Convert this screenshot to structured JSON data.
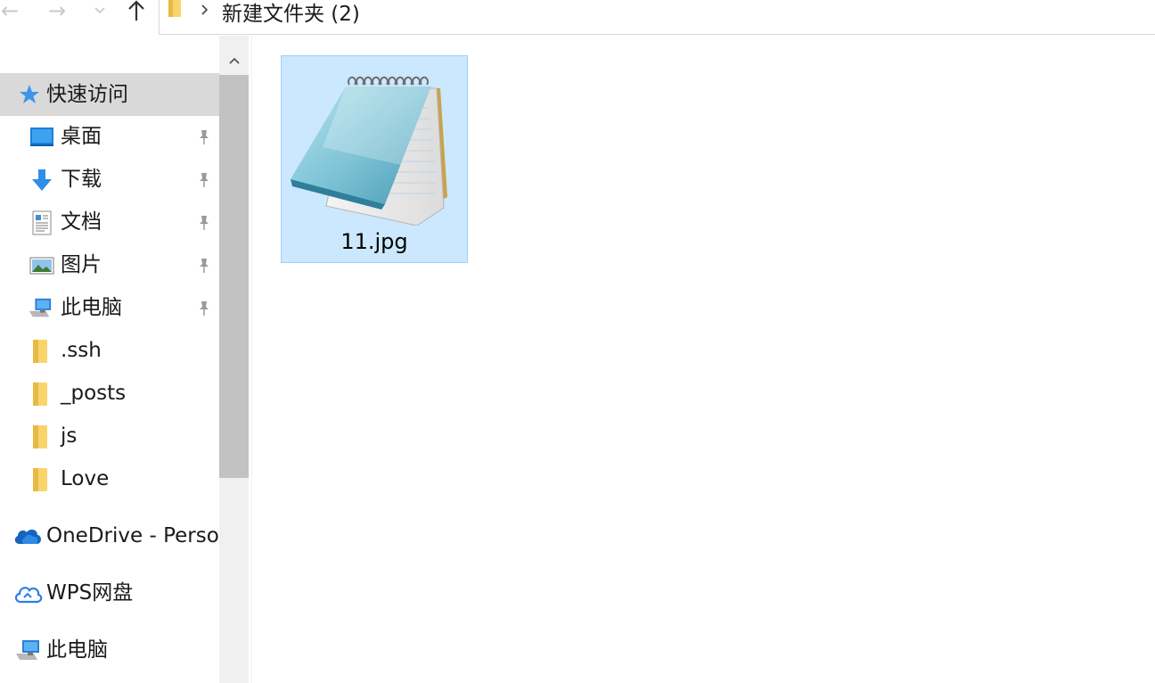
{
  "navigation": {
    "back": "←",
    "forward": "→",
    "recent": "⌄",
    "up": "↑"
  },
  "address": {
    "path": "新建文件夹 (2)"
  },
  "sidebar": {
    "quick_access": "快速访问",
    "pinned": [
      {
        "label": "桌面",
        "icon": "desktop-icon",
        "pinned": true
      },
      {
        "label": "下载",
        "icon": "download-icon",
        "pinned": true
      },
      {
        "label": "文档",
        "icon": "documents-icon",
        "pinned": true
      },
      {
        "label": "图片",
        "icon": "pictures-icon",
        "pinned": true
      },
      {
        "label": "此电脑",
        "icon": "computer-icon",
        "pinned": true
      }
    ],
    "folders": [
      {
        "label": ".ssh",
        "icon": "folder-icon"
      },
      {
        "label": "_posts",
        "icon": "folder-icon"
      },
      {
        "label": "js",
        "icon": "folder-icon"
      },
      {
        "label": "Love",
        "icon": "folder-icon"
      }
    ],
    "roots": [
      {
        "label": "OneDrive - Perso",
        "icon": "onedrive-icon"
      },
      {
        "label": "WPS网盘",
        "icon": "wps-cloud-icon"
      },
      {
        "label": "此电脑",
        "icon": "computer-icon"
      }
    ]
  },
  "files": [
    {
      "name": "11.jpg",
      "icon": "notepad-icon",
      "selected": true
    }
  ],
  "colors": {
    "selection_fill": "#cce8ff",
    "selection_border": "#99d1ff",
    "sidebar_header": "#d9d9d9",
    "scrollbar_track": "#f0f0f0",
    "scrollbar_thumb": "#c2c2c2",
    "folder": "#f7d56b",
    "accent": "#0078d4"
  }
}
